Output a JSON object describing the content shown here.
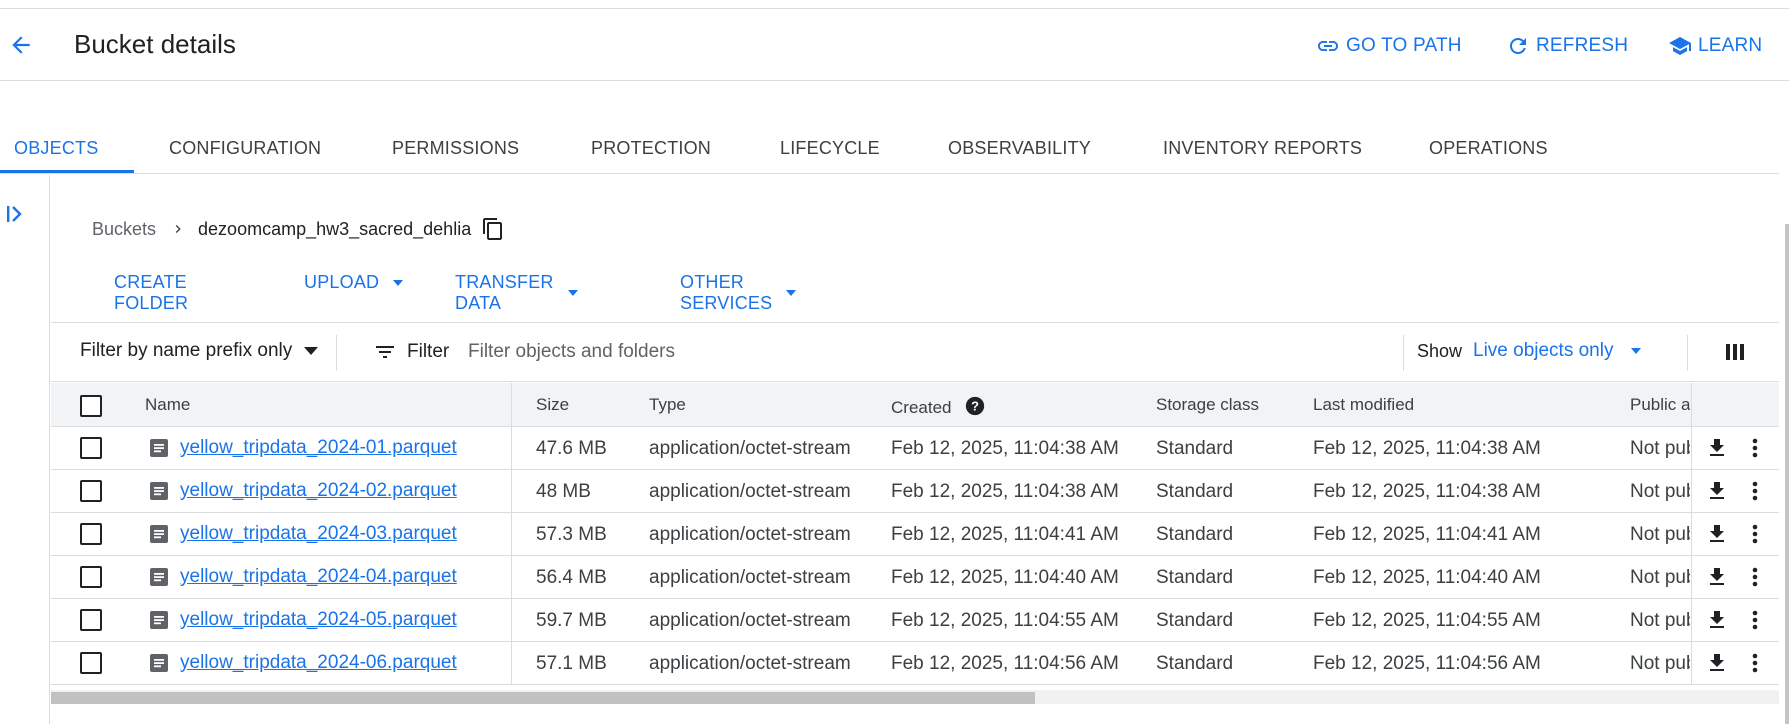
{
  "header": {
    "title": "Bucket details",
    "go_to_path": "GO TO PATH",
    "refresh": "REFRESH",
    "learn": "LEARN"
  },
  "tabs": [
    {
      "label": "OBJECTS",
      "active": true
    },
    {
      "label": "CONFIGURATION"
    },
    {
      "label": "PERMISSIONS"
    },
    {
      "label": "PROTECTION"
    },
    {
      "label": "LIFECYCLE"
    },
    {
      "label": "OBSERVABILITY"
    },
    {
      "label": "INVENTORY REPORTS"
    },
    {
      "label": "OPERATIONS"
    }
  ],
  "breadcrumb": {
    "root": "Buckets",
    "current": "dezoomcamp_hw3_sacred_dehlia"
  },
  "actions": {
    "create_folder": "CREATE FOLDER",
    "upload": "UPLOAD",
    "transfer_data": "TRANSFER DATA",
    "other_services": "OTHER SERVICES"
  },
  "filter": {
    "mode": "Filter by name prefix only",
    "button": "Filter",
    "placeholder": "Filter objects and folders",
    "show_label": "Show",
    "show_value": "Live objects only"
  },
  "table": {
    "columns": {
      "name": "Name",
      "size": "Size",
      "type": "Type",
      "created": "Created",
      "storage_class": "Storage class",
      "last_modified": "Last modified",
      "public_access": "Public access"
    },
    "rows": [
      {
        "name": "yellow_tripdata_2024-01.parquet",
        "size": "47.6 MB",
        "type": "application/octet-stream",
        "created": "Feb 12, 2025, 11:04:38 AM",
        "storage_class": "Standard",
        "last_modified": "Feb 12, 2025, 11:04:38 AM",
        "public": "Not public"
      },
      {
        "name": "yellow_tripdata_2024-02.parquet",
        "size": "48 MB",
        "type": "application/octet-stream",
        "created": "Feb 12, 2025, 11:04:38 AM",
        "storage_class": "Standard",
        "last_modified": "Feb 12, 2025, 11:04:38 AM",
        "public": "Not public"
      },
      {
        "name": "yellow_tripdata_2024-03.parquet",
        "size": "57.3 MB",
        "type": "application/octet-stream",
        "created": "Feb 12, 2025, 11:04:41 AM",
        "storage_class": "Standard",
        "last_modified": "Feb 12, 2025, 11:04:41 AM",
        "public": "Not public"
      },
      {
        "name": "yellow_tripdata_2024-04.parquet",
        "size": "56.4 MB",
        "type": "application/octet-stream",
        "created": "Feb 12, 2025, 11:04:40 AM",
        "storage_class": "Standard",
        "last_modified": "Feb 12, 2025, 11:04:40 AM",
        "public": "Not public"
      },
      {
        "name": "yellow_tripdata_2024-05.parquet",
        "size": "59.7 MB",
        "type": "application/octet-stream",
        "created": "Feb 12, 2025, 11:04:55 AM",
        "storage_class": "Standard",
        "last_modified": "Feb 12, 2025, 11:04:55 AM",
        "public": "Not public"
      },
      {
        "name": "yellow_tripdata_2024-06.parquet",
        "size": "57.1 MB",
        "type": "application/octet-stream",
        "created": "Feb 12, 2025, 11:04:56 AM",
        "storage_class": "Standard",
        "last_modified": "Feb 12, 2025, 11:04:56 AM",
        "public": "Not public"
      }
    ]
  },
  "icons": {
    "back": "arrow-back-icon",
    "link": "link-icon",
    "refresh": "refresh-icon",
    "learn": "school-icon",
    "rail": "expand-panel-icon",
    "chevron": "chevron-right-icon",
    "copy": "copy-icon",
    "filter": "filter-list-icon",
    "help": "help-icon",
    "columns": "column-display-icon",
    "file": "file-icon",
    "download": "download-icon",
    "more": "more-vert-icon"
  },
  "colors": {
    "accent": "#1a73e8",
    "text": "#202124",
    "border": "#dadce0",
    "header_bg": "#f1f3f4"
  }
}
